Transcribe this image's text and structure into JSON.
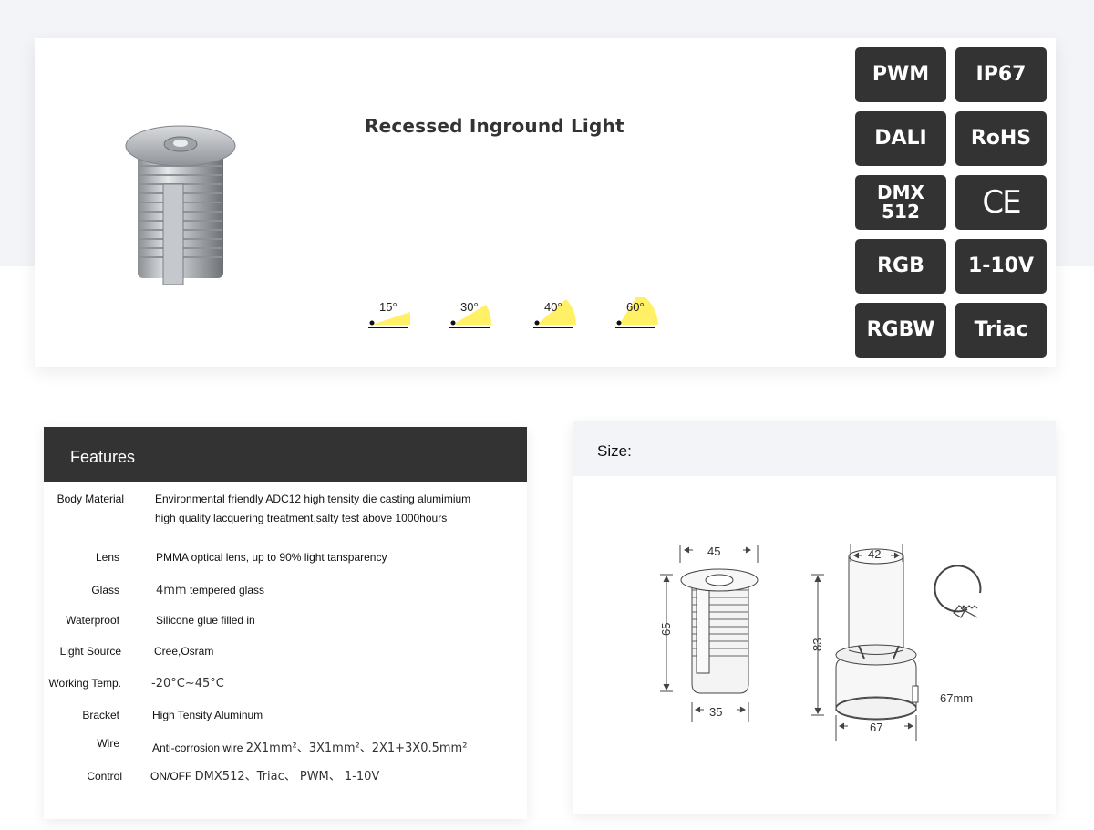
{
  "product": {
    "title": "Recessed Inground Light",
    "beam_angles": [
      "15°",
      "30°",
      "40°",
      "60°"
    ],
    "badges": [
      "PWM",
      "IP67",
      "DALI",
      "RoHS",
      "DMX\n512",
      "CE",
      "RGB",
      "1-10V",
      "RGBW",
      "Triac"
    ]
  },
  "features": {
    "header": "Features",
    "rows": [
      {
        "label": "Body Material",
        "value": [
          "Environmental friendly ADC12 high tensity die casting alumimium",
          "high quality lacquering treatment,salty test above 1000hours"
        ]
      },
      {
        "label": "Lens",
        "value": [
          "PMMA optical lens, up to 90% light tansparency"
        ]
      },
      {
        "label": "Glass",
        "value_prefix": "4mm",
        "value": [
          "tempered glass"
        ]
      },
      {
        "label": "Waterproof",
        "value": [
          "Silicone glue filled in"
        ]
      },
      {
        "label": "Light Source",
        "value": [
          "Cree,Osram"
        ]
      },
      {
        "label": "Working Temp.",
        "value_mono": "-20°C~45°C"
      },
      {
        "label": "Bracket",
        "value": [
          "High Tensity Aluminum"
        ]
      },
      {
        "label": "Wire",
        "value": [
          "Anti-corrosion wire"
        ],
        "value_mono": "2X1mm²、3X1mm²、2X1+3X0.5mm²"
      },
      {
        "label": "Control",
        "value": [
          "ON/OFF"
        ],
        "value_mono": "DMX512、Triac、 PWM、 1-10V"
      }
    ]
  },
  "size": {
    "header": "Size:",
    "dims": {
      "top_dia": "45",
      "height_a": "65",
      "bottom_dia_a": "35",
      "cap_dia": "42",
      "height_b": "83",
      "bottom_dia_b": "67",
      "cutout": "67mm"
    }
  },
  "colors": {
    "badge_bg": "#333333",
    "beam_fill": "#fff066",
    "header_bg": "#333333"
  }
}
